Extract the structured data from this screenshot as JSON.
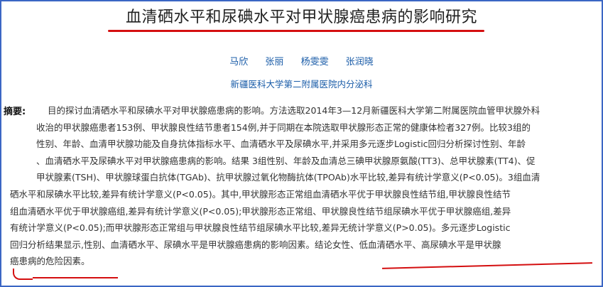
{
  "article": {
    "title": "血清硒水平和尿碘水平对甲状腺癌患病的影响研究",
    "authors": [
      "马欣",
      "张丽",
      "杨雯雯",
      "张润晓"
    ],
    "affiliation": "新疆医科大学第二附属医院内分泌科",
    "abstract_label": "摘要:",
    "abstract_lines": [
      "目的探讨血清硒水平和尿碘水平对甲状腺癌患病的影响。方法选取2014年3—12月新疆医科大学第二附属医院血管甲状腺外科",
      "收治的甲状腺癌患者153例、甲状腺良性结节患者154例,并于同期在本院选取甲状腺形态正常的健康体检者327例。比较3组的",
      "性别、年龄、血清甲状腺功能及自身抗体指标水平、血清硒水平及尿碘水平,并采用多元逐步Logistic回归分析探讨性别、年龄",
      "、血清硒水平及尿碘水平对甲状腺癌患病的影响。结果 3组性别、年龄及血清总三碘甲状腺原氨酸(TT3)、总甲状腺素(TT4)、促",
      "甲状腺素(TSH)、甲状腺球蛋白抗体(TGAb)、抗甲状腺过氧化物酶抗体(TPOAb)水平比较,差异有统计学意义(P<0.05)。3组血清",
      "硒水平和尿碘水平比较,差异有统计学意义(P<0.05)。其中,甲状腺形态正常组血清硒水平优于甲状腺良性结节组,甲状腺良性结节",
      "组血清硒水平优于甲状腺癌组,差异有统计学意义(P<0.05);甲状腺形态正常组、甲状腺良性结节组尿碘水平优于甲状腺癌组,差异",
      "有统计学意义(P<0.05);而甲状腺形态正常组与甲状腺良性结节组尿碘水平比较,差异无统计学意义(P>0.05)。多元逐步Logistic",
      "回归分析结果显示,性别、血清硒水平、尿碘水平是甲状腺癌患病的影响因素。结论女性、低血清硒水平、高尿碘水平是甲状腺",
      "癌患病的危险因素。"
    ]
  },
  "colors": {
    "frame_border": "#3b66c4",
    "annotation_red": "#d40f10",
    "link_blue": "#1a5ca8"
  }
}
